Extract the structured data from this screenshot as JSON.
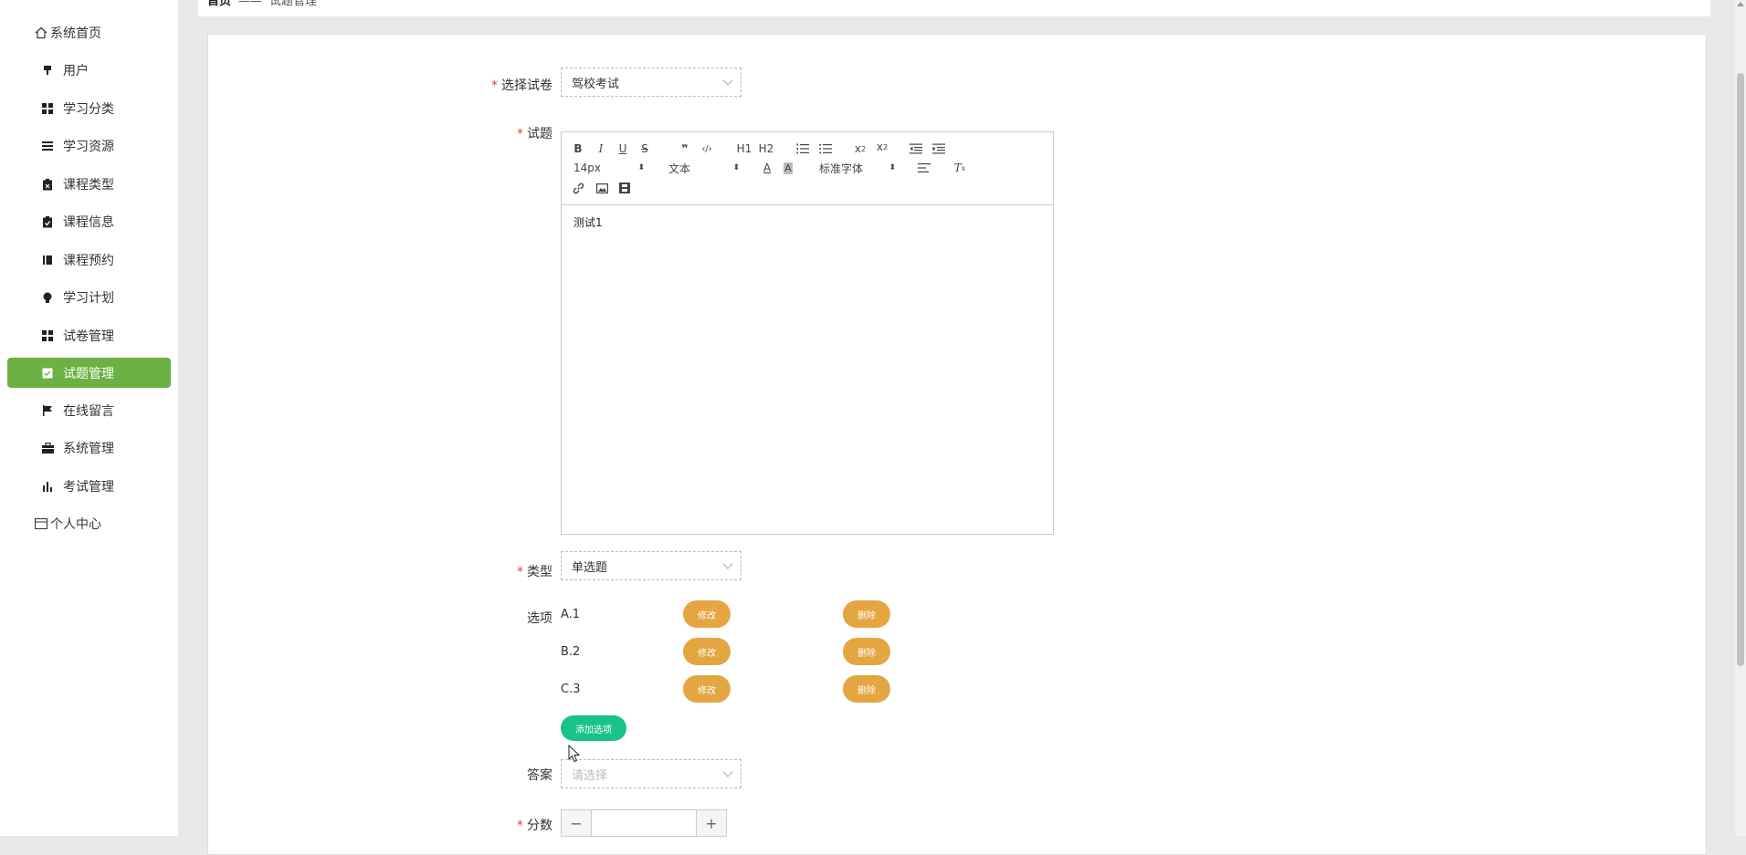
{
  "sidebar": {
    "items": [
      {
        "label": "系统首页",
        "icon": "home-icon"
      },
      {
        "label": "用户",
        "icon": "pin-icon"
      },
      {
        "label": "学习分类",
        "icon": "grid-icon"
      },
      {
        "label": "学习资源",
        "icon": "list-icon"
      },
      {
        "label": "课程类型",
        "icon": "clipboard-icon"
      },
      {
        "label": "课程信息",
        "icon": "clipboard-check-icon"
      },
      {
        "label": "课程预约",
        "icon": "book-icon"
      },
      {
        "label": "学习计划",
        "icon": "bulb-icon"
      },
      {
        "label": "试卷管理",
        "icon": "grid-icon"
      },
      {
        "label": "试题管理",
        "icon": "checkbox-icon"
      },
      {
        "label": "在线留言",
        "icon": "flag-icon"
      },
      {
        "label": "系统管理",
        "icon": "briefcase-icon"
      },
      {
        "label": "考试管理",
        "icon": "bar-chart-icon"
      },
      {
        "label": "个人中心",
        "icon": "card-icon"
      }
    ],
    "active_color": "#6bb143"
  },
  "breadcrumb": {
    "home": "首页",
    "sep": "——",
    "current": "试题管理"
  },
  "form": {
    "paper_label": "选择试卷",
    "paper_value": "驾校考试",
    "question_label": "试题",
    "editor_content": "测试1",
    "toolbar": {
      "font_size": "14px",
      "text_type": "文本",
      "font_family": "标准字体",
      "h1": "H1",
      "h2": "H2"
    },
    "type_label": "类型",
    "type_value": "单选题",
    "options_label": "选项",
    "options": [
      {
        "text": "A.1",
        "edit": "修改",
        "delete": "删除"
      },
      {
        "text": "B.2",
        "edit": "修改",
        "delete": "删除"
      },
      {
        "text": "C.3",
        "edit": "修改",
        "delete": "删除"
      }
    ],
    "add_option_label": "添加选项",
    "answer_label": "答案",
    "answer_placeholder": "请选择",
    "score_label": "分数",
    "required_mark": "*"
  },
  "colors": {
    "orange_button": "#e4a640",
    "green_button": "#19c28a",
    "required": "#e0453c"
  }
}
